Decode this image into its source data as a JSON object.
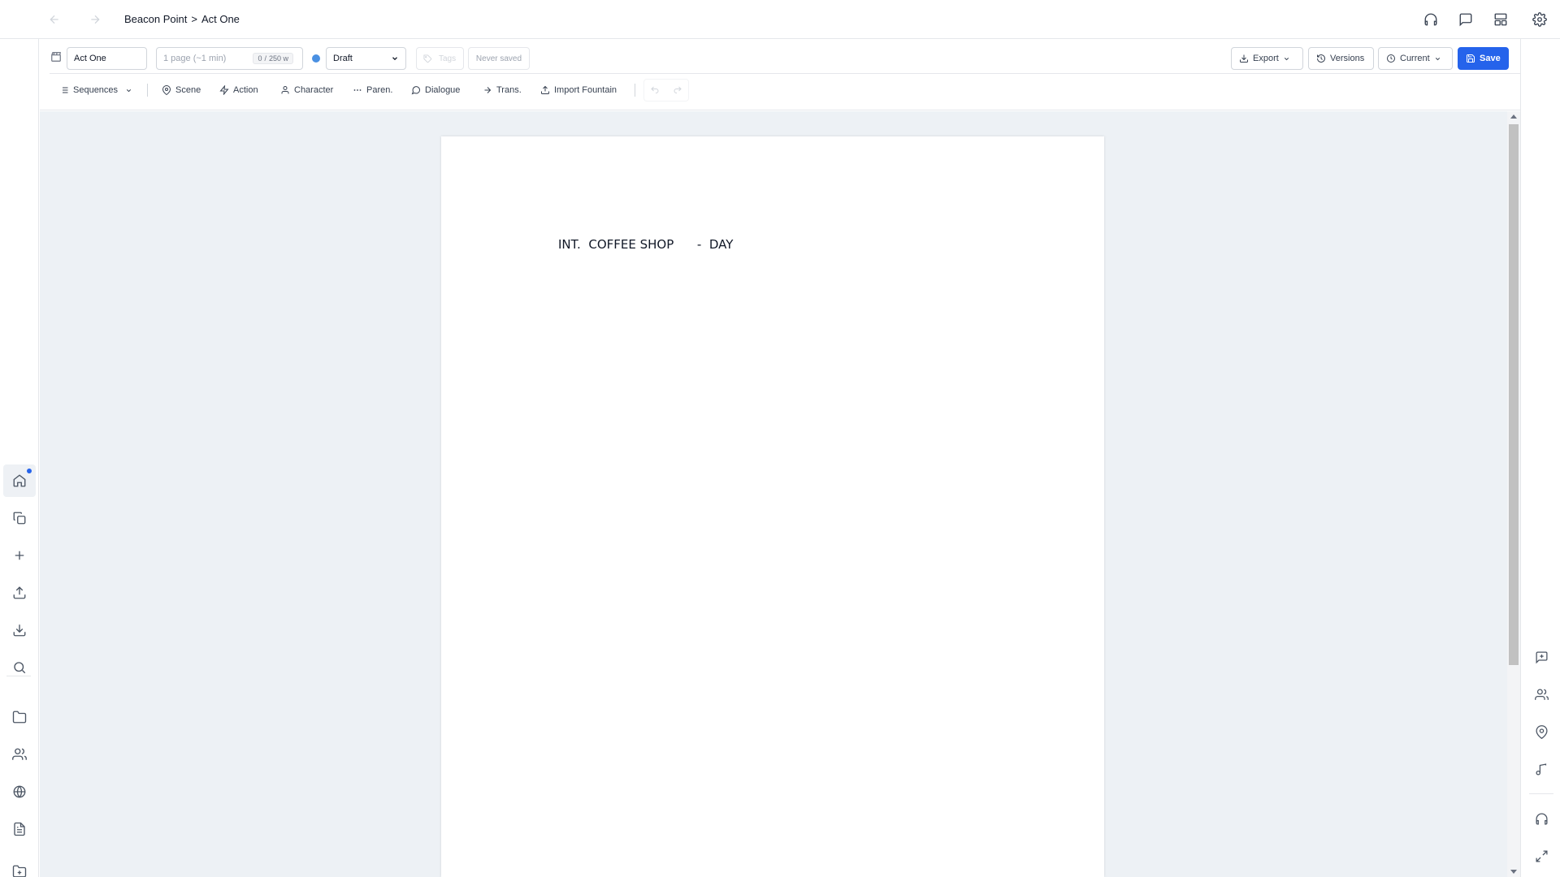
{
  "nav": {
    "back_icon": "arrow-left-icon",
    "forward_icon": "arrow-right-icon",
    "breadcrumb": {
      "project": "Beacon Point",
      "separator": ">",
      "document": "Act One"
    },
    "top_icons": [
      "headphones-icon",
      "message-square-icon",
      "layout-grid-icon",
      "gear-icon"
    ]
  },
  "header": {
    "doc_icon": "clapperboard-icon",
    "title_value": "Act One",
    "page_estimate": "1 page (~1 min)",
    "word_count": {
      "current": "0",
      "separator": "/",
      "target": "250 w"
    },
    "status_color": "#4a90e2",
    "status_selected": "Draft",
    "tags_placeholder": "Tags",
    "save_state": "Never saved",
    "export_label": "Export",
    "versions_label": "Versions",
    "current_label": "Current",
    "save_label": "Save",
    "accent_color": "#2563eb"
  },
  "toolbar": {
    "sequences": "Sequences",
    "scene": "Scene",
    "action": "Action",
    "character": "Character",
    "parenthetical": "Paren.",
    "dialogue": "Dialogue",
    "transition": "Trans.",
    "import_fountain": "Import Fountain"
  },
  "script": {
    "scene_heading": {
      "prefix": "INT.",
      "location": "COFFEE SHOP",
      "separator": "-",
      "time": "DAY"
    }
  },
  "left_sidebar": [
    "home-icon",
    "copy-icon",
    "plus-icon",
    "upload-icon",
    "download-icon",
    "search-icon",
    "folder-icon",
    "users-icon",
    "globe-icon",
    "file-text-icon",
    "folder-plus-icon"
  ],
  "right_sidebar": [
    "message-plus-icon",
    "users-icon",
    "map-pin-icon",
    "music-icon",
    "headphones-icon",
    "maximize-icon"
  ]
}
